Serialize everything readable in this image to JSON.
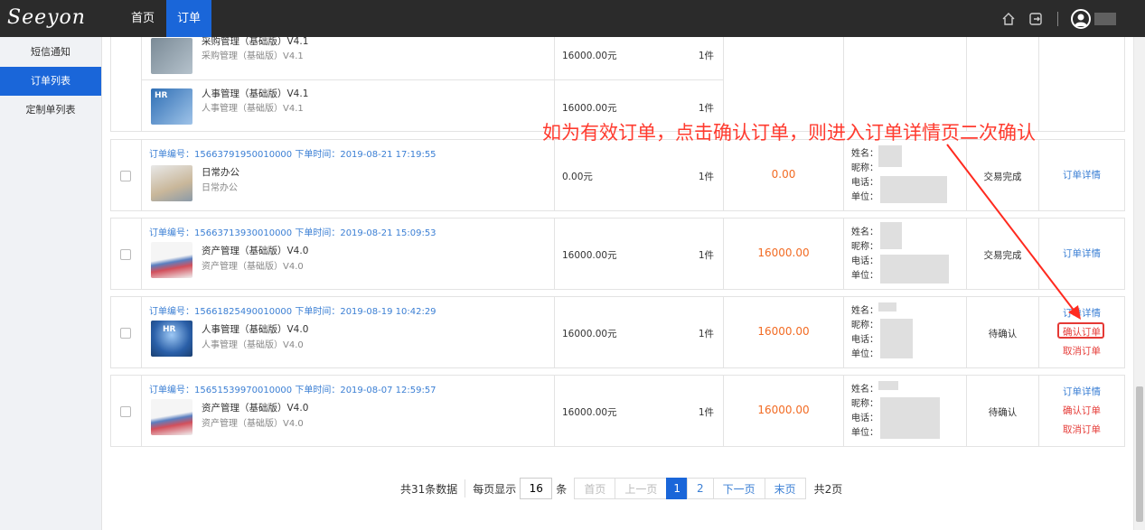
{
  "topbar": {
    "logo": "Seeyon",
    "nav": [
      {
        "label": "首页"
      },
      {
        "label": "订单"
      }
    ]
  },
  "sidebar": {
    "items": [
      {
        "label": "短信通知"
      },
      {
        "label": "订单列表"
      },
      {
        "label": "定制单列表"
      }
    ]
  },
  "annotation": "如为有效订单，点击确认订单，则进入订单详情页二次确认",
  "partial_order": {
    "products": [
      {
        "name": "采购管理（基础版）V4.1",
        "sub": "采购管理（基础版）V4.1",
        "price": "16000.00元",
        "qty": "1件"
      },
      {
        "name": "人事管理（基础版）V4.1",
        "sub": "人事管理（基础版）V4.1",
        "price": "16000.00元",
        "qty": "1件"
      }
    ]
  },
  "buyer_labels": {
    "name": "姓名：",
    "nick": "昵称：",
    "phone": "电话：",
    "unit": "单位："
  },
  "orders": [
    {
      "header": "订单编号：15663791950010000 下单时间：2019-08-21 17:19:55",
      "product": "日常办公",
      "sub": "日常办公",
      "price": "0.00元",
      "qty": "1件",
      "total": "0.00",
      "status": "交易完成",
      "actions": [
        "订单详情"
      ]
    },
    {
      "header": "订单编号：15663713930010000 下单时间：2019-08-21 15:09:53",
      "product": "资产管理（基础版）V4.0",
      "sub": "资产管理（基础版）V4.0",
      "price": "16000.00元",
      "qty": "1件",
      "total": "16000.00",
      "status": "交易完成",
      "actions": [
        "订单详情"
      ]
    },
    {
      "header": "订单编号：15661825490010000 下单时间：2019-08-19 10:42:29",
      "product": "人事管理（基础版）V4.0",
      "sub": "人事管理（基础版）V4.0",
      "price": "16000.00元",
      "qty": "1件",
      "total": "16000.00",
      "status": "待确认",
      "actions": [
        "订单详情",
        "确认订单",
        "取消订单"
      ]
    },
    {
      "header": "订单编号：15651539970010000 下单时间：2019-08-07 12:59:57",
      "product": "资产管理（基础版）V4.0",
      "sub": "资产管理（基础版）V4.0",
      "price": "16000.00元",
      "qty": "1件",
      "total": "16000.00",
      "status": "待确认",
      "actions": [
        "订单详情",
        "确认订单",
        "取消订单"
      ]
    }
  ],
  "pagination": {
    "total_text": "共31条数据",
    "per_page_label": "每页显示",
    "per_page_value": "16",
    "per_page_unit": "条",
    "first": "首页",
    "prev": "上一页",
    "pages": [
      "1",
      "2"
    ],
    "next": "下一页",
    "last": "末页",
    "page_count": "共2页"
  },
  "colors": {
    "accent": "#1a66d9",
    "link": "#3b7fd4",
    "price": "#f26b23",
    "alert": "#e53935",
    "topbar": "#2b2b2b"
  }
}
